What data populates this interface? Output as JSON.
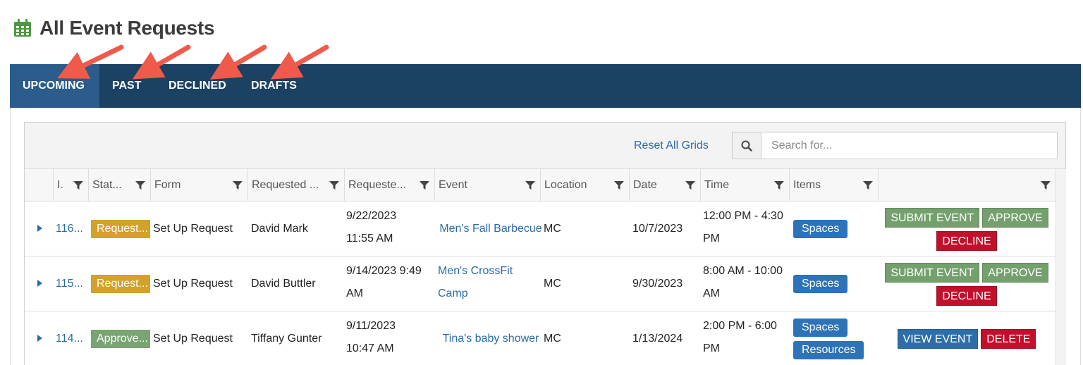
{
  "page": {
    "title": "All Event Requests"
  },
  "tabs": [
    {
      "label": "UPCOMING",
      "active": true
    },
    {
      "label": "PAST",
      "active": false
    },
    {
      "label": "DECLINED",
      "active": false
    },
    {
      "label": "DRAFTS",
      "active": false
    }
  ],
  "toolbar": {
    "reset_label": "Reset All Grids",
    "search_placeholder": "Search for..."
  },
  "columns": [
    "I.",
    "Stat...",
    "Form",
    "Requested ...",
    "Requeste...",
    "Event",
    "Location",
    "Date",
    "Time",
    "Items",
    ""
  ],
  "rows": [
    {
      "id": "116...",
      "status": "Request...",
      "status_type": "requested",
      "form": "Set Up Request",
      "requested_by": "David Mark",
      "requested_on": [
        "9/22/2023",
        "11:55 AM"
      ],
      "event": [
        "Men's Fall Barbecue"
      ],
      "location": "MC",
      "date": "10/7/2023",
      "time": [
        "12:00 PM - 4:30",
        "PM"
      ],
      "items": [
        "Spaces"
      ],
      "actions": [
        "SUBMIT EVENT",
        "APPROVE",
        "DECLINE"
      ]
    },
    {
      "id": "115...",
      "status": "Request...",
      "status_type": "requested",
      "form": "Set Up Request",
      "requested_by": "David Buttler",
      "requested_on": [
        "9/14/2023 9:49",
        "AM"
      ],
      "event": [
        "Men's CrossFit",
        "Camp"
      ],
      "location": "MC",
      "date": "9/30/2023",
      "time": [
        "8:00 AM - 10:00",
        "AM"
      ],
      "items": [
        "Spaces"
      ],
      "actions": [
        "SUBMIT EVENT",
        "APPROVE",
        "DECLINE"
      ]
    },
    {
      "id": "114...",
      "status": "Approve...",
      "status_type": "approved",
      "form": "Set Up Request",
      "requested_by": "Tiffany Gunter",
      "requested_on": [
        "9/11/2023",
        "10:47 AM"
      ],
      "event": [
        "Tina's baby shower"
      ],
      "location": "MC",
      "date": "1/13/2024",
      "time": [
        "2:00 PM - 6:00",
        "PM"
      ],
      "items": [
        "Spaces",
        "Resources"
      ],
      "actions": [
        "VIEW EVENT",
        "DELETE"
      ]
    }
  ],
  "colors": {
    "tabbar": "#1b4163",
    "tab_active": "#2b5c8c",
    "link": "#2a6aa8",
    "requested": "#d4a12a",
    "approved": "#78a572",
    "green_btn": "#74a06d",
    "red_btn": "#c0102c",
    "arrow": "#f05a4a"
  }
}
